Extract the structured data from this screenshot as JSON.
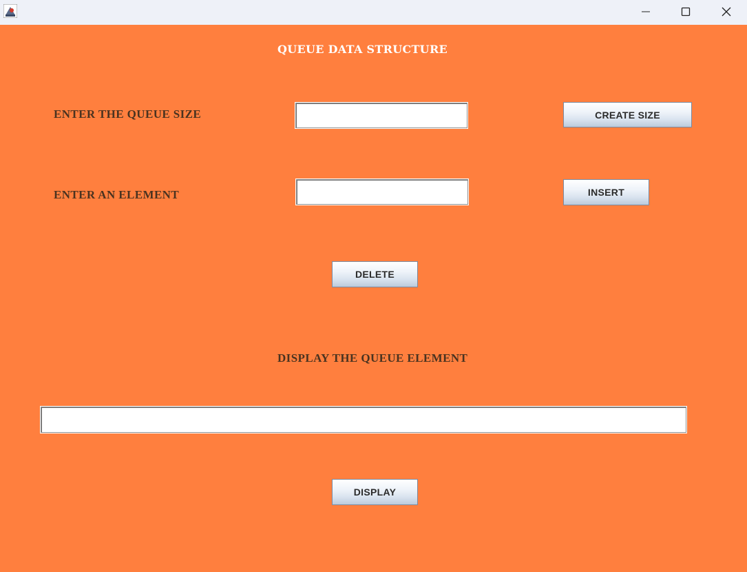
{
  "window": {
    "icon": "java-app-icon",
    "controls": {
      "minimize_icon": "minimize-icon",
      "maximize_icon": "maximize-icon",
      "close_icon": "close-icon"
    }
  },
  "form": {
    "title": "QUEUE DATA STRUCTURE",
    "size_label": "ENTER THE QUEUE SIZE",
    "size_value": "",
    "create_size_button": "CREATE SIZE",
    "element_label": "ENTER AN ELEMENT",
    "element_value": "",
    "insert_button": "INSERT",
    "delete_button": "DELETE",
    "display_label": "DISPLAY THE QUEUE ELEMENT",
    "display_value": "",
    "display_button": "DISPLAY"
  },
  "colors": {
    "background": "#ff7f3e",
    "title_text": "#ffffff",
    "label_text": "#4a3320",
    "titlebar": "#eef1f8"
  }
}
